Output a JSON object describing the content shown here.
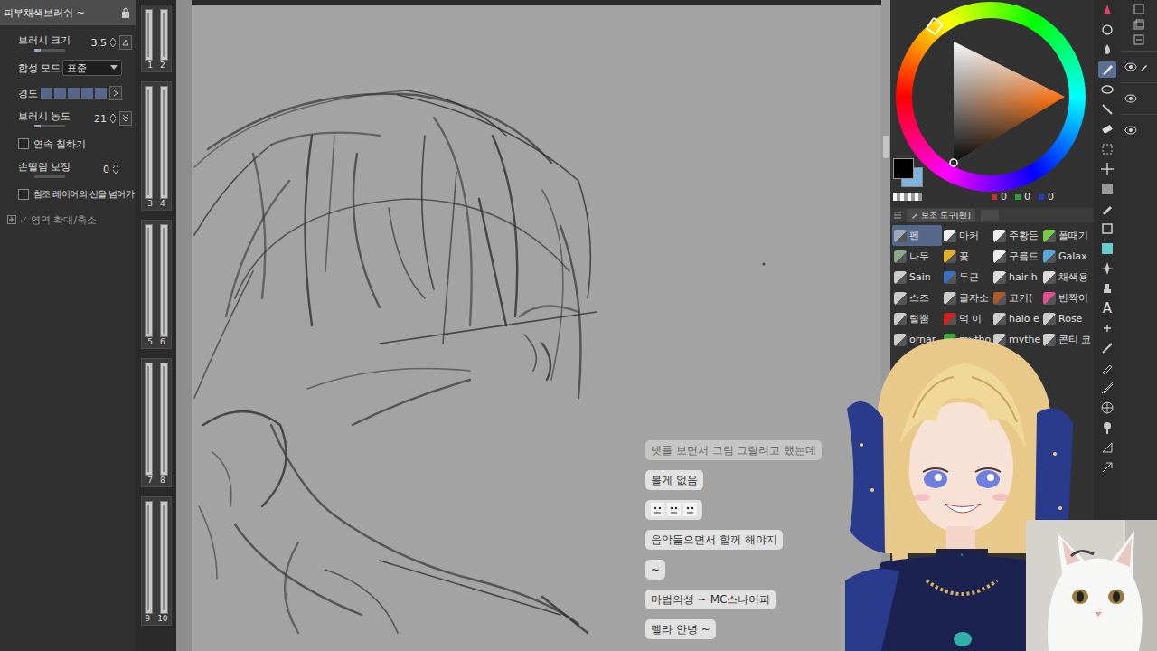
{
  "tool_property": {
    "title": "피부채색브러쉬 ~",
    "rows": [
      {
        "kind": "spin",
        "label": "브러시 크기",
        "value": "3.5",
        "level": 0.2
      },
      {
        "kind": "dropdown",
        "label": "합성 모드",
        "value": "표준"
      },
      {
        "kind": "blocks",
        "label": "경도",
        "level": 1
      },
      {
        "kind": "spin",
        "label": "브러시 농도",
        "value": "21",
        "level": 0.21
      },
      {
        "kind": "checkbox",
        "label": "연속 칠하기",
        "checked": false
      },
      {
        "kind": "spin",
        "label": "손떨림 보정",
        "value": "0",
        "level": 0
      },
      {
        "kind": "checkbox",
        "label": "참조 레이어의 선을 넘어가",
        "checked": false
      },
      {
        "kind": "expander",
        "label": "영역 확대/축소",
        "expanded": false
      }
    ]
  },
  "brush_sizes": [
    [
      "1",
      "2"
    ],
    [
      "3",
      "4"
    ],
    [
      "5",
      "6"
    ],
    [
      "7",
      "8"
    ],
    [
      "9",
      "10"
    ]
  ],
  "color": {
    "main": "#000000",
    "sub": "#7fb3e0",
    "values": [
      {
        "value": "0",
        "color": "#c83232"
      },
      {
        "value": "0",
        "color": "#2e9e3a"
      },
      {
        "value": "0",
        "color": "#2040c0"
      }
    ]
  },
  "subtool": {
    "title": "보조 도구[펜]",
    "items": [
      {
        "label": "펜",
        "selected": true,
        "color": "#9aaabb"
      },
      {
        "label": "마커",
        "selected": false,
        "color": "#eeeeee"
      },
      {
        "label": "주황든",
        "selected": false,
        "color": "#eeeeee"
      },
      {
        "label": "폴때기",
        "selected": false,
        "color": "#77cc44"
      },
      {
        "label": "나무",
        "selected": false,
        "color": "#88aa88"
      },
      {
        "label": "꽃",
        "selected": false,
        "color": "#e0b020"
      },
      {
        "label": "구름드",
        "selected": false,
        "color": "#eeeeee"
      },
      {
        "label": "Galax",
        "selected": false,
        "color": "#55aadd"
      },
      {
        "label": "Sain",
        "selected": false,
        "color": "#cccccc"
      },
      {
        "label": "두근",
        "selected": false,
        "color": "#3a6fc0"
      },
      {
        "label": "hair h",
        "selected": false,
        "color": "#dddddd"
      },
      {
        "label": "채색용",
        "selected": false,
        "color": "#dddddd"
      },
      {
        "label": "스즈",
        "selected": false,
        "color": "#cccccc"
      },
      {
        "label": "글자소",
        "selected": false,
        "color": "#cccccc"
      },
      {
        "label": "고기(",
        "selected": false,
        "color": "#b05a2a"
      },
      {
        "label": "반짝이",
        "selected": false,
        "color": "#e05090"
      },
      {
        "label": "털뿜",
        "selected": false,
        "color": "#cccccc"
      },
      {
        "label": "먹 이",
        "selected": false,
        "color": "#d02020"
      },
      {
        "label": "halo e",
        "selected": false,
        "color": "#cccccc"
      },
      {
        "label": "Rose",
        "selected": false,
        "color": "#cccccc"
      },
      {
        "label": "ornar",
        "selected": false,
        "color": "#cccccc"
      },
      {
        "label": "mytho",
        "selected": false,
        "color": "#33aa33"
      },
      {
        "label": "mythe",
        "selected": false,
        "color": "#cccccc"
      },
      {
        "label": "콘티 코",
        "selected": false,
        "color": "#cccccc"
      }
    ]
  },
  "tools": [
    {
      "selected": false
    },
    {
      "selected": false
    },
    {
      "selected": false
    },
    {
      "selected": true
    },
    {
      "selected": false
    },
    {
      "selected": false
    },
    {
      "selected": false
    },
    {
      "selected": false
    },
    {
      "selected": false
    },
    {
      "selected": false
    },
    {
      "selected": false
    },
    {
      "selected": false
    },
    {
      "selected": false
    },
    {
      "selected": false
    },
    {
      "selected": false
    },
    {
      "label": "A",
      "selected": false
    },
    {
      "selected": false
    },
    {
      "selected": false
    },
    {
      "selected": false
    },
    {
      "selected": false
    },
    {
      "selected": false
    },
    {
      "selected": false
    },
    {
      "selected": false
    },
    {
      "selected": false
    }
  ],
  "layers": [
    {
      "visible": true,
      "editing": true
    },
    {
      "visible": true,
      "editing": false
    },
    {
      "visible": true,
      "editing": false
    }
  ],
  "chat": [
    {
      "kind": "text",
      "text": "넷플 보면서 그림 그릴려고 했는데",
      "faded": true
    },
    {
      "kind": "text",
      "text": "볼게 없음",
      "faded": false
    },
    {
      "kind": "emote",
      "faded": false
    },
    {
      "kind": "text",
      "text": "음악들으면서 할꺼 해야지",
      "faded": false
    },
    {
      "kind": "text",
      "text": "~",
      "faded": false
    },
    {
      "kind": "text",
      "text": "마법의성 ~ MC스나이퍼",
      "faded": false
    },
    {
      "kind": "text",
      "text": "멜라 안녕 ~",
      "faded": false
    }
  ]
}
